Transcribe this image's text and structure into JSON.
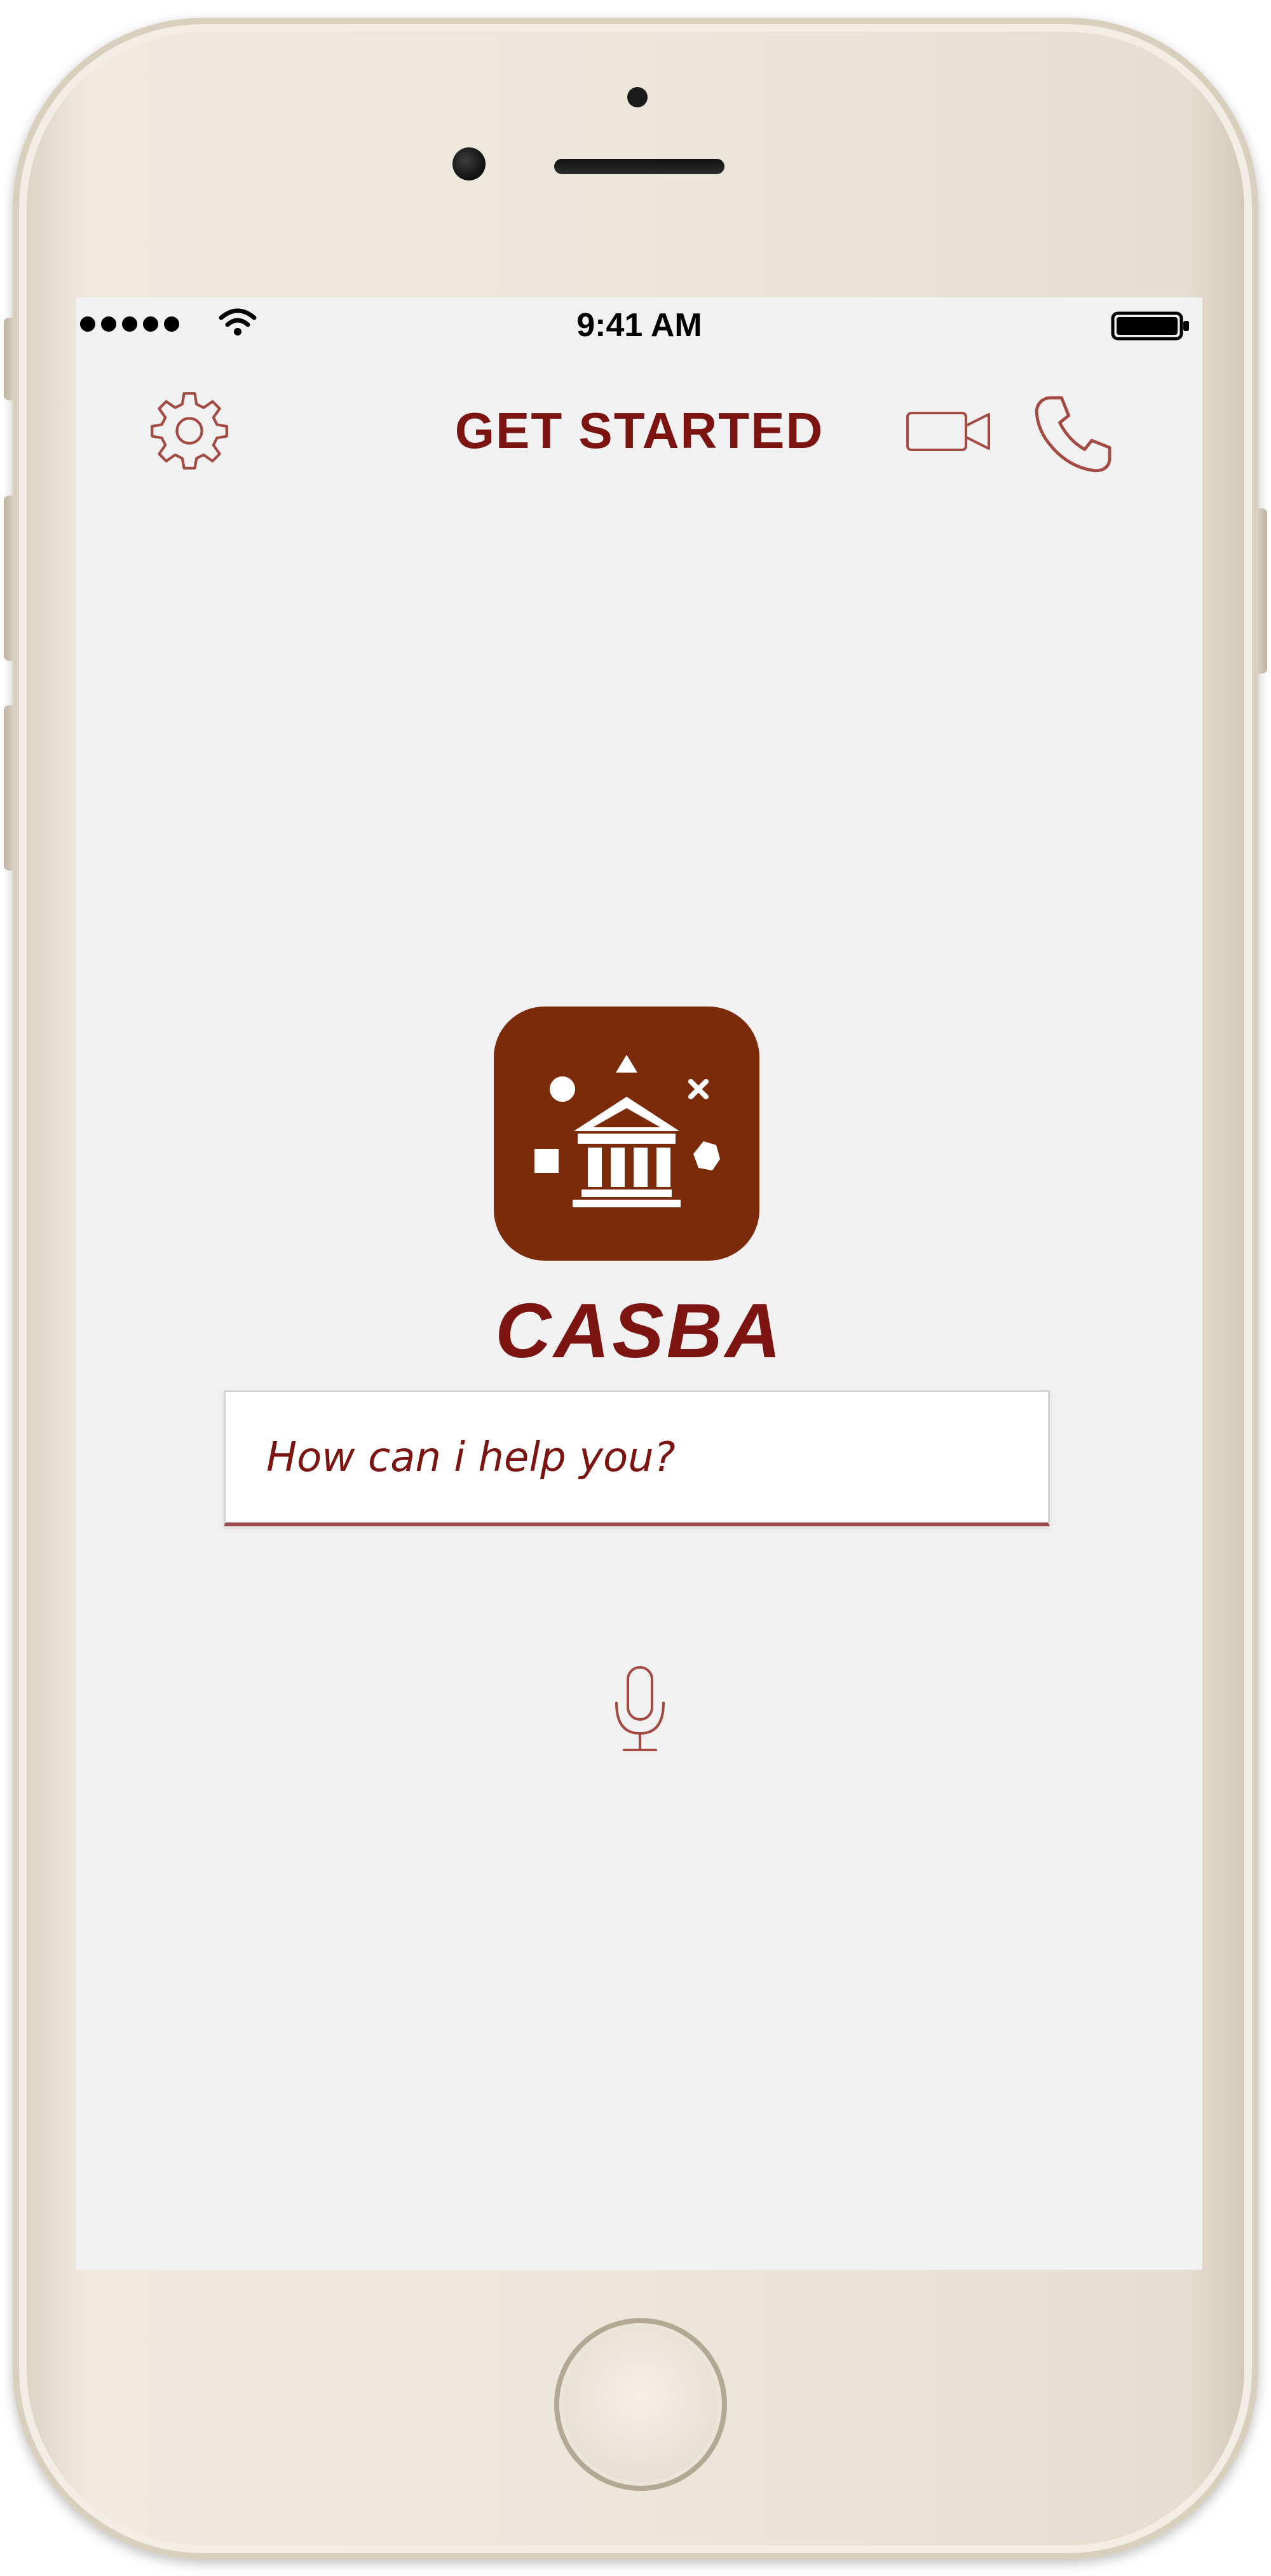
{
  "status_bar": {
    "time": "9:41 AM",
    "signal_icon": "signal-dots-icon",
    "wifi_icon": "wifi-icon",
    "battery_icon": "battery-icon"
  },
  "nav_bar": {
    "title": "GET STARTED",
    "left_icon": "gear-icon",
    "right_icons": [
      "video-camera-icon",
      "phone-icon"
    ]
  },
  "brand": {
    "logo_icon": "bank-building-icon",
    "name": "CASBA"
  },
  "search": {
    "placeholder": "How can i help you?",
    "value": ""
  },
  "voice": {
    "icon": "microphone-icon"
  },
  "colors": {
    "accent": "#7c1411",
    "logo_background": "#7b2b0a",
    "screen_background": "#f2f1f1",
    "icon_stroke": "#a34a42",
    "phone_body": "#ece6db"
  }
}
